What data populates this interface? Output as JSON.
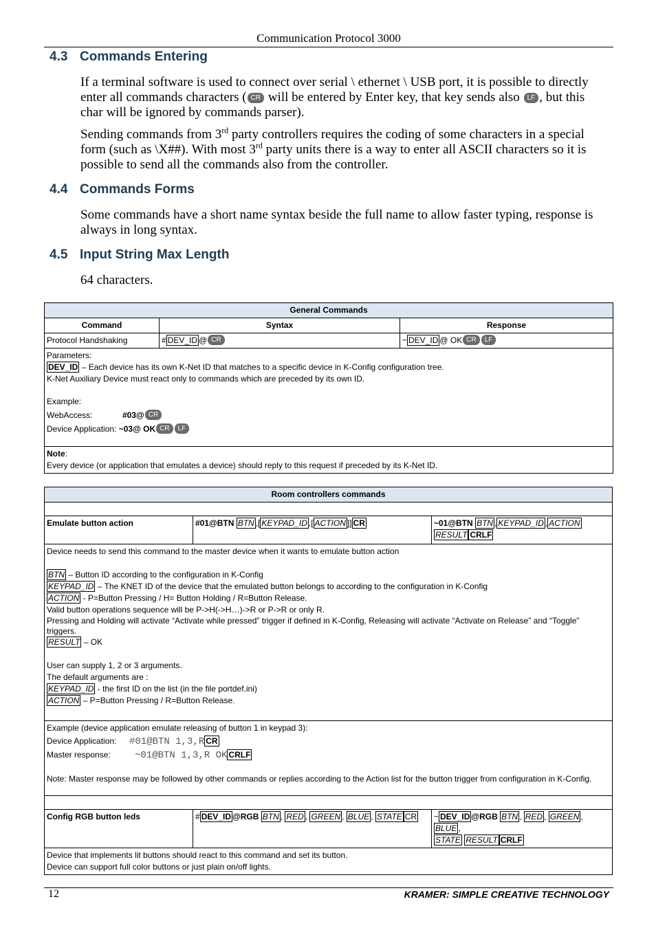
{
  "header": {
    "title": "Communication Protocol 3000"
  },
  "sections": [
    {
      "number": "4.3",
      "title": "Commands Entering",
      "p1_a": "If a terminal software is used to connect over serial \\ ethernet \\ USB port, it is possible to directly enter all commands characters (",
      "p1_b": " will be entered by Enter key, that key sends also ",
      "p1_c": ", but this char will be ignored by commands parser).",
      "p2_a": "Sending commands from 3",
      "p2_sup": "rd",
      "p2_b": " party controllers requires the coding of some characters in a special form (such as \\X##). With most 3",
      "p2_c": " party units there is a way to enter all ASCII characters so it is possible to send all the commands also from the controller."
    },
    {
      "number": "4.4",
      "title": "Commands Forms",
      "p1": "Some commands have a short name syntax beside the full name to allow faster typing, response is always in long syntax."
    },
    {
      "number": "4.5",
      "title": "Input String Max Length",
      "p1": "64 characters."
    }
  ],
  "glyphs": {
    "cr": "CR",
    "lf": "LF",
    "crlf": "CRLF"
  },
  "general_table": {
    "title": "General Commands",
    "columns": [
      "Command",
      "Syntax",
      "Response"
    ],
    "row": {
      "command": "Protocol Handshaking",
      "syntax_prefix": "#",
      "syntax_param": "DEV_ID",
      "syntax_suffix": "@",
      "response_prefix": "~",
      "response_param": "DEV_ID",
      "response_suffix": "@ OK"
    },
    "parameters_label": "Parameters:",
    "param_name": "DEV_ID",
    "param_desc": " – Each device has its own K-Net ID that matches to a specific device in K-Config configuration tree.",
    "param_note": "K-Net Auxiliary Device must react only to commands which are preceded by its own ID.",
    "example_label": "Example:",
    "example_web_label": "WebAccess:",
    "example_web_value": "#03@",
    "example_dev_label": "Device Application: ",
    "example_dev_value": "~03@ OK",
    "note_label": "Note",
    "note_text": "Every device (or application that emulates a device) should reply to this request if preceded by its K-Net ID."
  },
  "room_table": {
    "title": "Room controllers commands",
    "emulate": {
      "name": "Emulate button action",
      "syntax_prefix": "#01@BTN ",
      "p_btn": "BTN",
      "p_keypad": "KEYPAD_ID",
      "p_action": "ACTION",
      "p_result": "RESULT",
      "response_prefix": "~01@BTN ",
      "description": "Device needs to send this command to the master device when it wants to emulate button action",
      "btn_desc": " – Button ID according to the configuration in K-Config",
      "keypad_desc": " – The KNET ID of the device that the emulated button belongs to according to the configuration in K-Config",
      "action_desc": " - P=Button Pressing / H= Button Holding / R=Button Release.",
      "sequence": "Valid button operations sequence will be P->H(->H…)->R or P->R or only R.",
      "triggers": "Pressing and Holding will activate “Activate while pressed” trigger if defined in K-Config, Releasing will activate “Activate on Release” and “Toggle” triggers.",
      "result_desc": " – OK",
      "args": "User can supply 1, 2 or 3 arguments.",
      "defaults": "The default arguments are :",
      "default_keypad": " - the first ID on the list (in the file portdef.ini)",
      "default_action": " – P=Button Pressing / R=Button Release.",
      "example_title": "Example (device application emulate releasing of button 1 in keypad 3):",
      "example_dev_label": "Device Application:",
      "example_dev_value": "#01@BTN 1,3,R",
      "example_master_label": "Master response:",
      "example_master_value": "~01@BTN 1,3,R OK",
      "example_note": "Note: Master response may be followed by other commands or replies according to the Action list for the button trigger from configuration in K-Config."
    },
    "rgb": {
      "name": "Config RGB button leds",
      "syntax_prefix": "#",
      "p_devid": "DEV_ID",
      "cmd": "@RGB ",
      "p_btn": "BTN",
      "p_red": "RED",
      "p_green": "GREEN",
      "p_blue": "BLUE",
      "p_state": "STATE",
      "p_result": "RESULT",
      "response_prefix": "~",
      "desc1": "Device that implements lit buttons should react to this command and set its button.",
      "desc2": "Device can support full color buttons or just plain on/off lights."
    }
  },
  "footer": {
    "page": "12",
    "brand": "KRAMER:  SIMPLE CREATIVE TECHNOLOGY"
  }
}
